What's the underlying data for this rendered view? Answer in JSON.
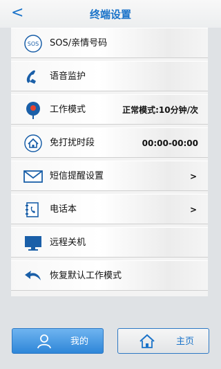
{
  "header": {
    "title": "终端设置",
    "back_glyph": "<"
  },
  "rows": [
    {
      "icon": "sos-icon",
      "label": "SOS/亲情号码",
      "value": ""
    },
    {
      "icon": "phone-handset-icon",
      "label": "语音监护",
      "value": ""
    },
    {
      "icon": "location-pin-icon",
      "label": "工作模式",
      "value": "正常模式:10分钟/次"
    },
    {
      "icon": "home-icon",
      "label": "免打扰时段",
      "value": "00:00-00:00"
    },
    {
      "icon": "envelope-icon",
      "label": "短信提醒设置",
      "value": ">"
    },
    {
      "icon": "phonebook-icon",
      "label": "电话本",
      "value": ">"
    },
    {
      "icon": "monitor-icon",
      "label": "远程关机",
      "value": ""
    },
    {
      "icon": "restore-arrow-icon",
      "label": "恢复默认工作模式",
      "value": ""
    }
  ],
  "tabs": {
    "mine": "我的",
    "home": "主页"
  },
  "colors": {
    "accent": "#1a73c9",
    "tab_active": "#2e86d8"
  }
}
